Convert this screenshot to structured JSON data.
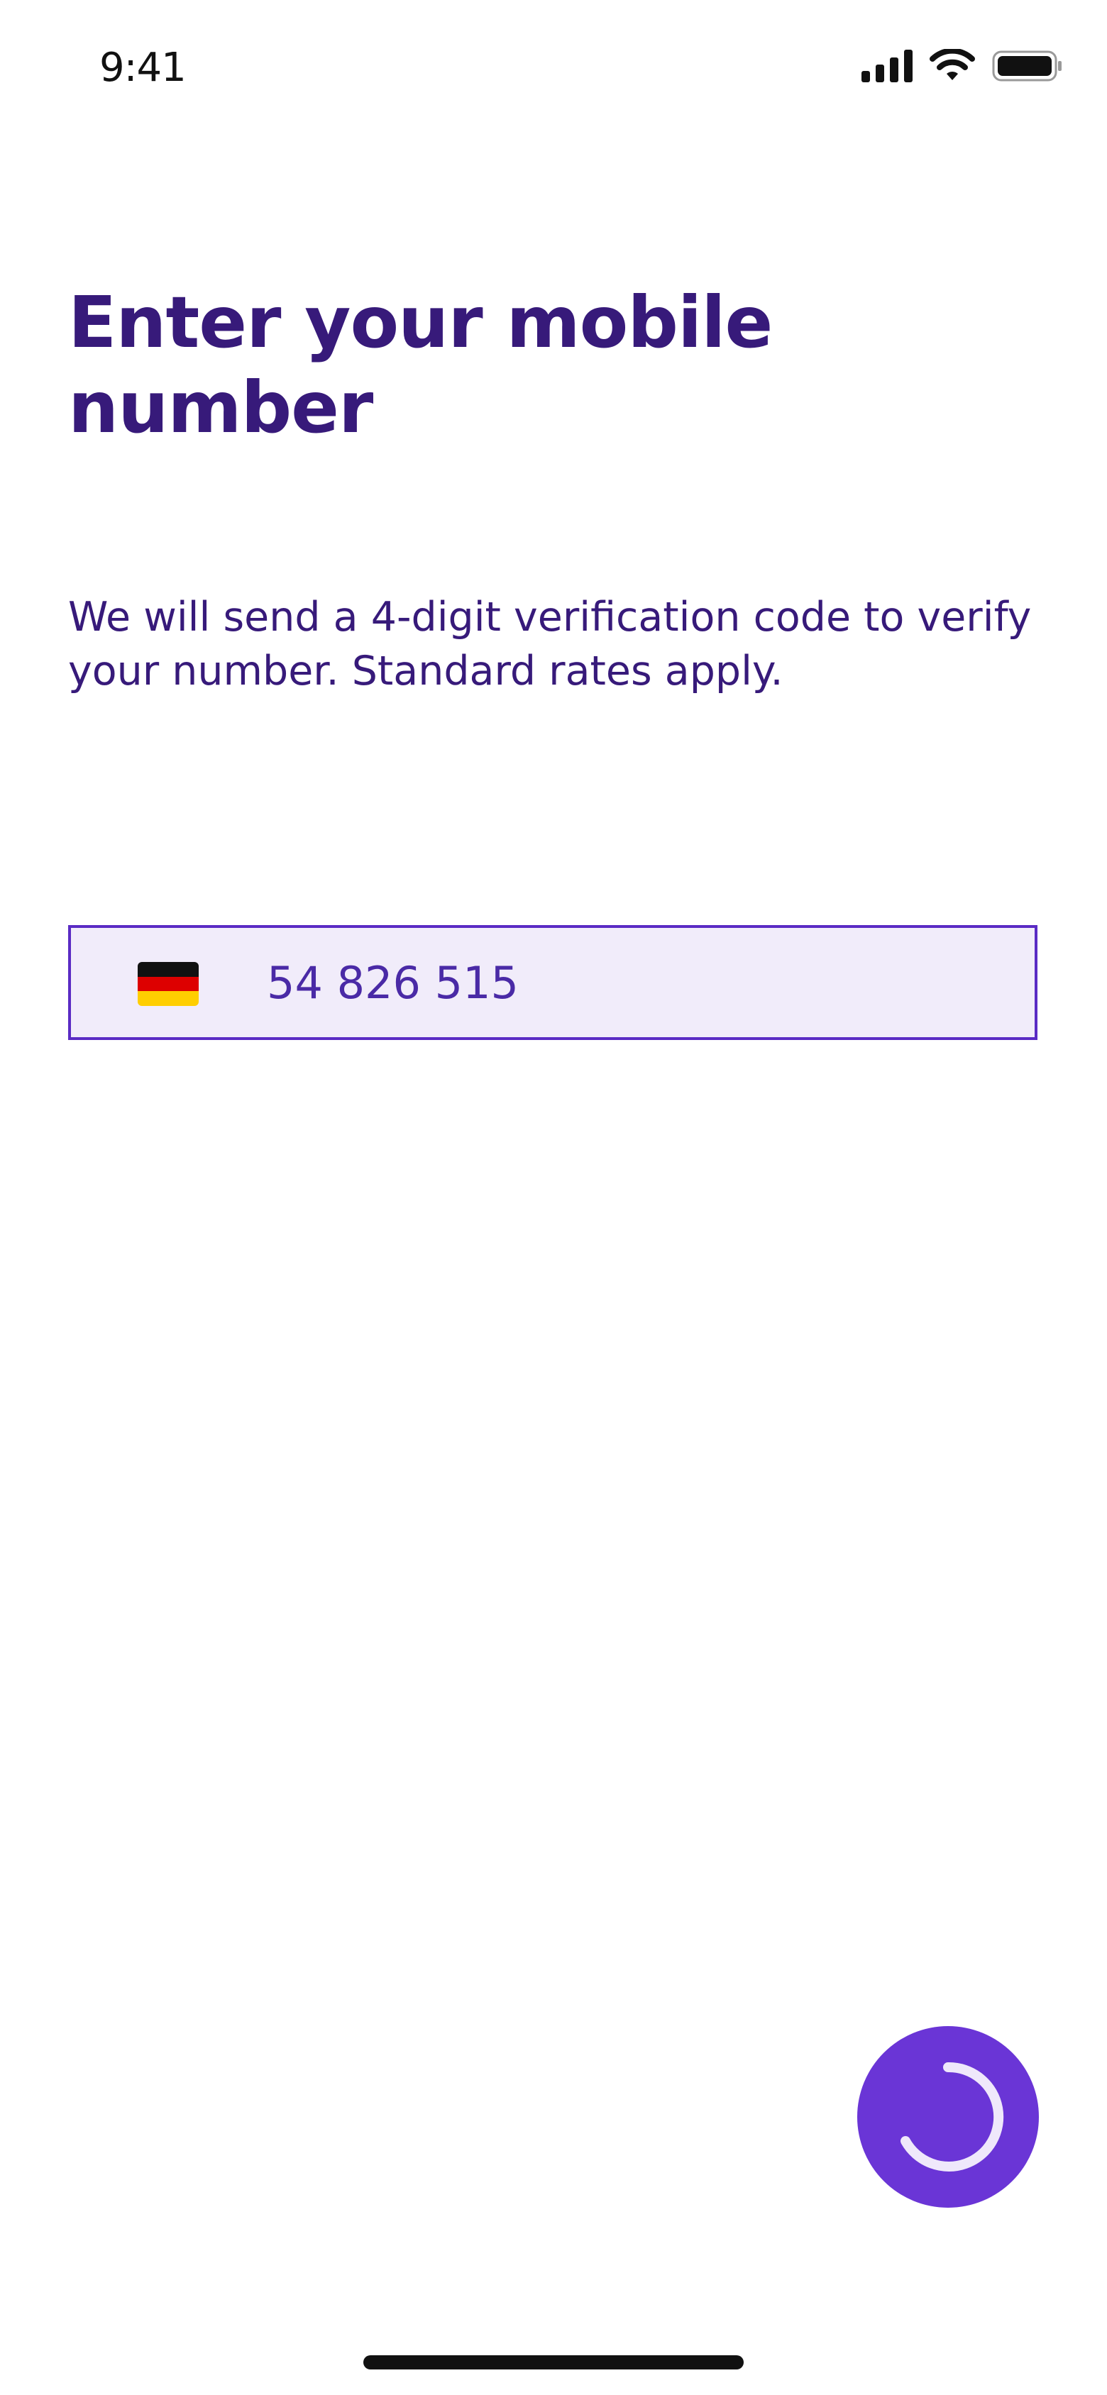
{
  "status_bar": {
    "time": "9:41",
    "icons": [
      "signal-icon",
      "wifi-icon",
      "battery-icon"
    ]
  },
  "title": "Enter your mobile number",
  "description": "We will send a 4-digit verification code to verify your number. Standard rates apply.",
  "phone_input": {
    "country_flag": "germany-flag-icon",
    "value": "54 826 515"
  },
  "fab": {
    "icon": "loading-spinner-icon"
  },
  "colors": {
    "primary_text": "#371a7a",
    "accent": "#6a35d6",
    "field_border": "#5a2bc4",
    "field_background": "#f1ecfa"
  }
}
